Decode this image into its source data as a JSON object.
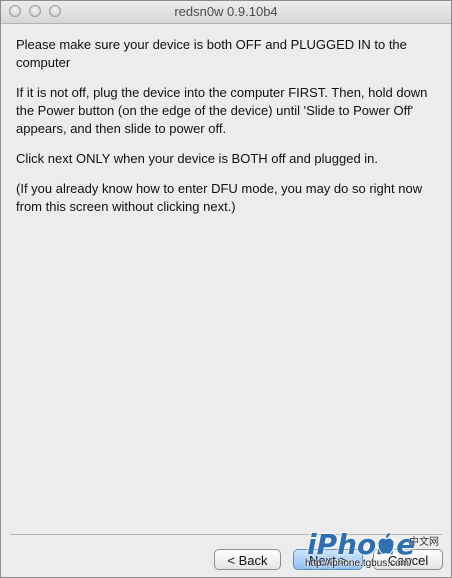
{
  "window": {
    "title": "redsn0w 0.9.10b4"
  },
  "instructions": {
    "p1": "Please make sure your device is both OFF and PLUGGED IN to the computer",
    "p2": "If it is not off, plug the device into the computer FIRST. Then, hold down the Power button (on the edge of the device) until 'Slide to Power Off' appears, and then slide to power off.",
    "p3": "Click next ONLY when your device is BOTH off and plugged in.",
    "p4": "(If you already know how to enter DFU mode, you may do so right now from this screen without clicking next.)"
  },
  "buttons": {
    "back": "< Back",
    "next": "Next >",
    "cancel": "Cancel"
  },
  "watermark": {
    "brand": "iPhone",
    "chinese": "中文网",
    "url": "http://iphone.tgbus.com/"
  },
  "icons": [
    "close-icon",
    "minimize-icon",
    "zoom-icon",
    "apple-logo-icon"
  ]
}
